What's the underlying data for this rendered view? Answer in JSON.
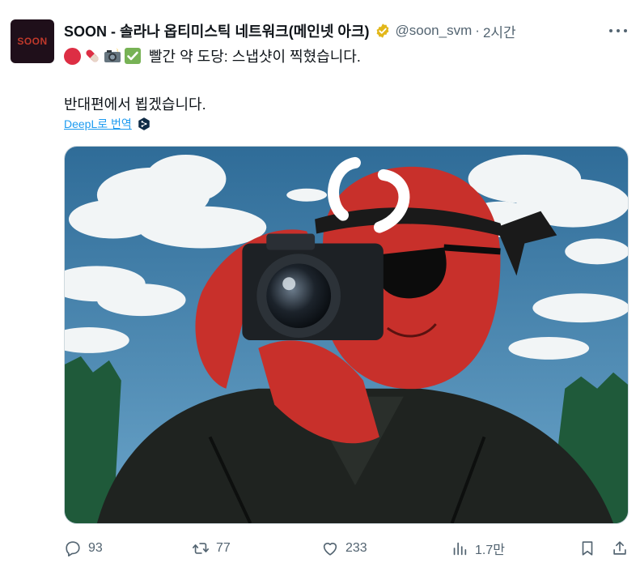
{
  "author": {
    "avatar_text": "SOON",
    "display_name": "SOON - 솔라나 옵티미스틱 네트워크(메인넷 아크)",
    "handle": "@soon_svm",
    "separator": "·",
    "time": "2시간",
    "verified": true,
    "verified_color": "#e2b719"
  },
  "tweet": {
    "emojis": [
      "red-circle",
      "pill",
      "camera-with-flash",
      "check-mark-button"
    ],
    "line1": "빨간 약 도당: 스냅샷이 찍혔습니다.",
    "line2": "반대편에서 뵙겠습니다.",
    "translate_label": "DeepL로 번역"
  },
  "actions": {
    "reply_count": "93",
    "retweet_count": "77",
    "like_count": "233",
    "views_count": "1.7만"
  },
  "colors": {
    "text": "#0f1419",
    "secondary": "#536471",
    "link": "#1d9bf0"
  }
}
